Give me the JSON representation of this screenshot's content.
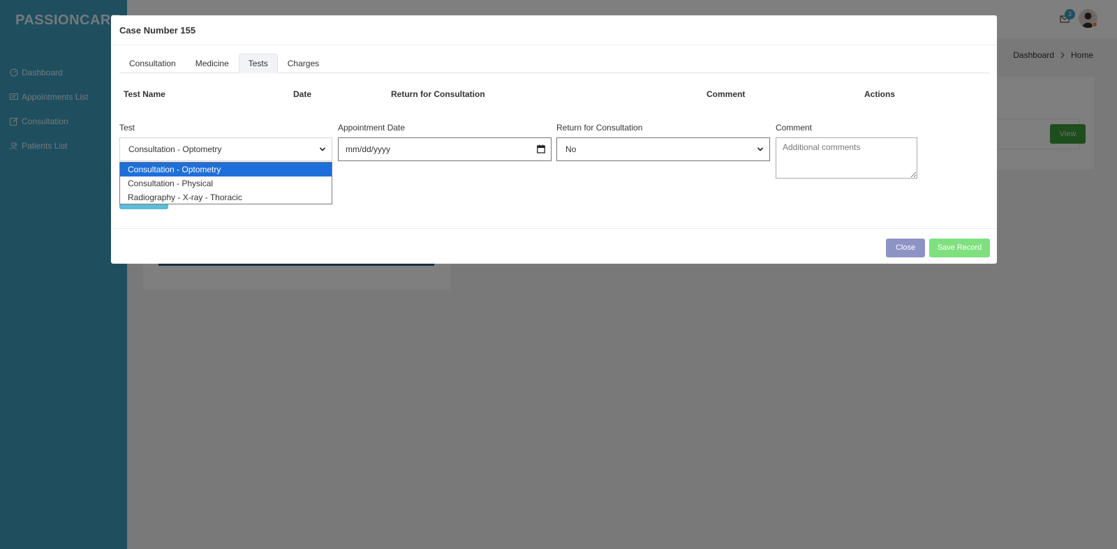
{
  "app": {
    "brand": "PASSIONCARE"
  },
  "sidebar": {
    "items": [
      {
        "label": "Dashboard",
        "icon": "dashboard-icon"
      },
      {
        "label": "Appointments List",
        "icon": "message-icon"
      },
      {
        "label": "Consultation",
        "icon": "edit-icon"
      },
      {
        "label": "Patients List",
        "icon": "users-icon"
      }
    ]
  },
  "header": {
    "mail_count": "3"
  },
  "breadcrumb": {
    "items": [
      "Dashboard",
      "Home"
    ]
  },
  "background_card": {
    "view_label": "View"
  },
  "modal": {
    "title": "Case Number 155",
    "tabs": [
      {
        "label": "Consultation",
        "active": false
      },
      {
        "label": "Medicine",
        "active": false
      },
      {
        "label": "Tests",
        "active": true
      },
      {
        "label": "Charges",
        "active": false
      }
    ],
    "table_headers": [
      "Test Name",
      "Date",
      "Return for Consultation",
      "Comment",
      "Actions"
    ],
    "form": {
      "test_label": "Test",
      "test_value": "Consultation - Optometry",
      "test_options": [
        "Consultation - Optometry",
        "Consultation - Physical",
        "Radiography - X-ray - Thoracic"
      ],
      "date_label": "Appointment Date",
      "date_value": "mm/dd/yyyy",
      "return_label": "Return for Consultation",
      "return_value": "No",
      "comment_label": "Comment",
      "comment_placeholder": "Additional comments"
    },
    "close_label": "Close",
    "save_label": "Save Record"
  },
  "colors": {
    "sidebar": "#3e9fbf",
    "overlay": "rgba(0,0,0,0.5)",
    "selected_option": "#1e6fd9",
    "close_button": "#8e93c6",
    "save_button": "#7fe07f",
    "view_button": "#3d9a3c"
  }
}
